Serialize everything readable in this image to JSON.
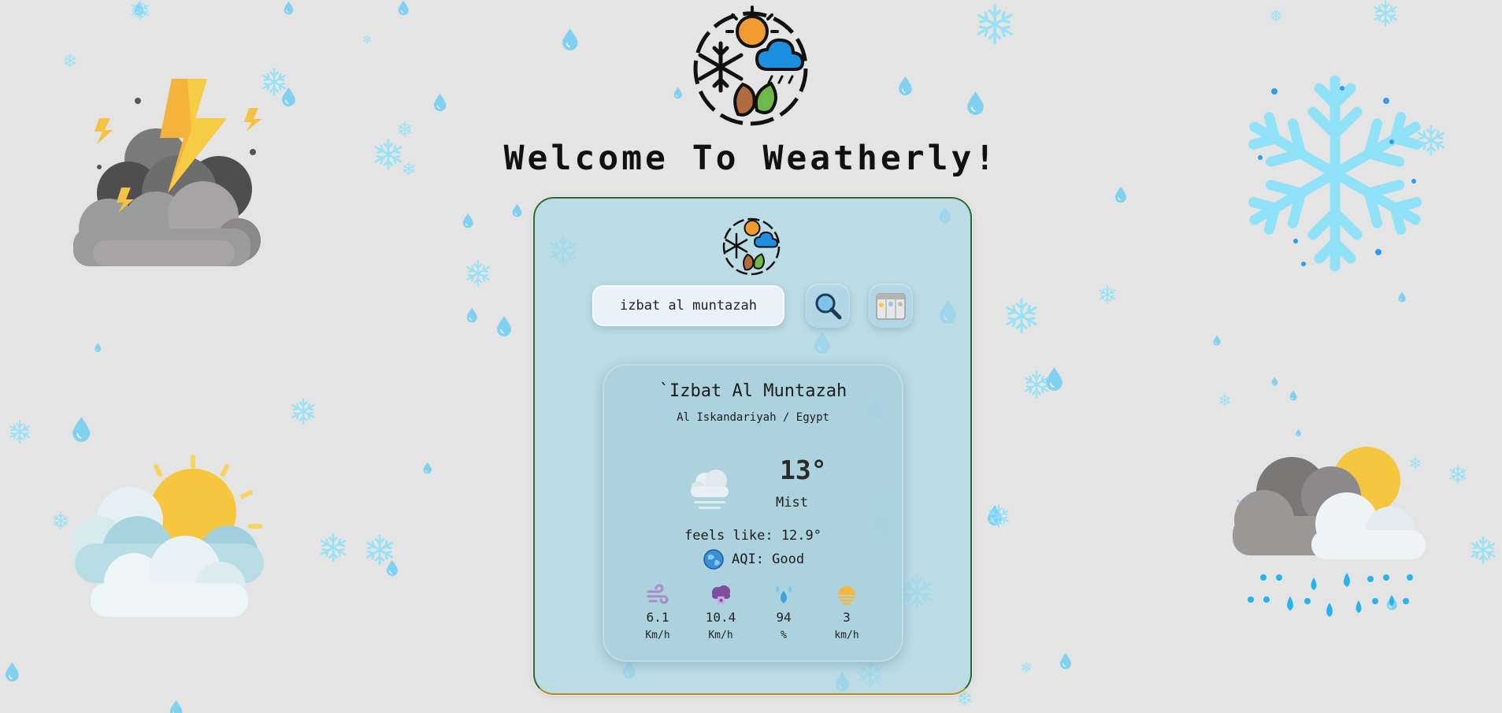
{
  "app": {
    "welcome_title": "Welcome To Weatherly!",
    "logo_icon": "weatherly-seasons-logo-icon"
  },
  "search": {
    "value": "izbat al muntazah",
    "search_icon": "magnifier-icon",
    "calendar_icon": "forecast-calendar-icon"
  },
  "location": {
    "city": "`Izbat Al Muntazah",
    "region": "Al Iskandariyah / Egypt"
  },
  "current": {
    "temperature": "13°",
    "condition": "Mist",
    "condition_icon": "mist-cloud-icon",
    "feels_like": "feels like: 12.9°",
    "aqi": "AQI: Good",
    "aqi_icon": "globe-icon"
  },
  "stats": [
    {
      "icon": "wind-icon",
      "value": "6.1",
      "unit": "Km/h"
    },
    {
      "icon": "gust-cloud-icon",
      "value": "10.4",
      "unit": "Km/h"
    },
    {
      "icon": "humidity-drops-icon",
      "value": "94",
      "unit": "%"
    },
    {
      "icon": "visibility-sun-icon",
      "value": "3",
      "unit": "km/h"
    }
  ],
  "colors": {
    "background": "#e4e4e4",
    "panel": "#aad7e4",
    "rain_drop": "#6ecdf2",
    "snowflake": "#8fe2f7",
    "sun": "#f6c945"
  }
}
